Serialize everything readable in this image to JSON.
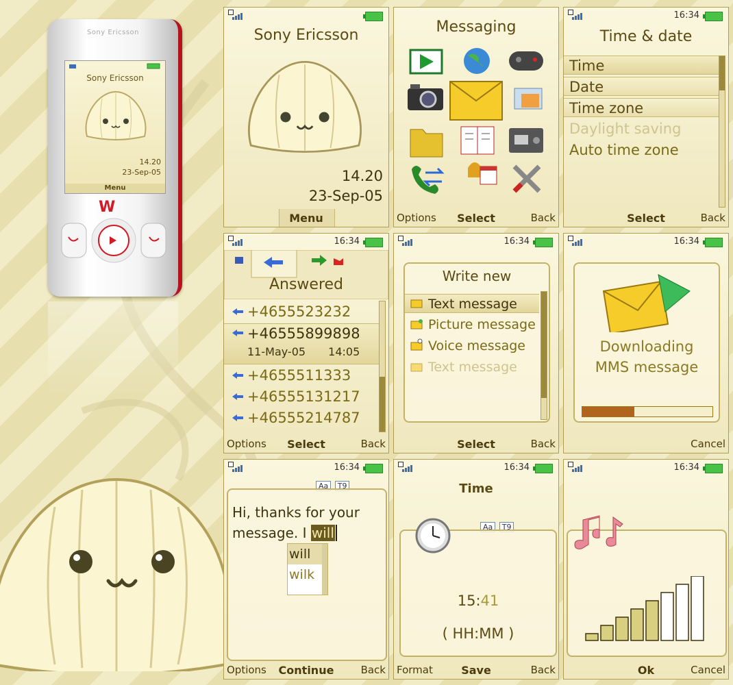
{
  "phone": {
    "brand": "Sony Ericsson",
    "screen_title": "Sony Ericsson",
    "time": "14.20",
    "date": "23-Sep-05",
    "menu": "Menu"
  },
  "standby": {
    "title": "Sony Ericsson",
    "time": "14.20",
    "date": "23-Sep-05",
    "center_key": "Menu"
  },
  "messaging": {
    "title": "Messaging",
    "left_key": "Options",
    "center_key": "Select",
    "right_key": "Back",
    "icons": [
      "media-player-icon",
      "internet-globe-icon",
      "games-controller-icon",
      "camera-icon",
      "messaging-envelope-icon",
      "pictures-icon",
      "file-folder-icon",
      "phonebook-icon",
      "radio-icon",
      "calls-icon",
      "alarm-calendar-icon",
      "settings-tools-icon"
    ]
  },
  "time_date": {
    "clock": "16:34",
    "title": "Time & date",
    "items": [
      "Time",
      "Date",
      "Time zone",
      "Daylight saving",
      "Auto time zone"
    ],
    "center_key": "Select",
    "right_key": "Back"
  },
  "calls": {
    "clock": "16:34",
    "tab_title": "Answered",
    "numbers": [
      "+4655523232",
      "+46555899898",
      "+4655511333",
      "+46555131217",
      "+46555214787"
    ],
    "detail_date": "11-May-05",
    "detail_time": "14:05",
    "left_key": "Options",
    "center_key": "Select",
    "right_key": "Back"
  },
  "write_new": {
    "clock": "16:34",
    "title": "Write new",
    "items": [
      "Text message",
      "Picture message",
      "Voice message",
      "Text message"
    ],
    "center_key": "Select",
    "right_key": "Back"
  },
  "downloading": {
    "clock": "16:34",
    "line1": "Downloading",
    "line2": "MMS message",
    "progress": 0.4,
    "right_key": "Cancel"
  },
  "editor": {
    "clock": "16:34",
    "badge1": "Aa",
    "badge2": "T9",
    "line1": "Hi, thanks for your",
    "line2_prefix": "message. I ",
    "highlight": "will",
    "suggestions": [
      "will",
      "wilk"
    ],
    "left_key": "Options",
    "center_key": "Continue",
    "right_key": "Back"
  },
  "time_set": {
    "clock": "16:34",
    "title": "Time",
    "badge1": "Aa",
    "badge2": "T9",
    "time_hh": "15:",
    "time_mm": "41",
    "format": "( HH:MM )",
    "left_key": "Format",
    "center_key": "Save",
    "right_key": "Back"
  },
  "volume": {
    "clock": "16:34",
    "level_filled": 5,
    "level_total": 8,
    "center_key": "Ok",
    "right_key": "Cancel"
  },
  "colors": {
    "accent": "#5b4a12",
    "panel": "#c3b166",
    "progress": "#b0641c"
  }
}
